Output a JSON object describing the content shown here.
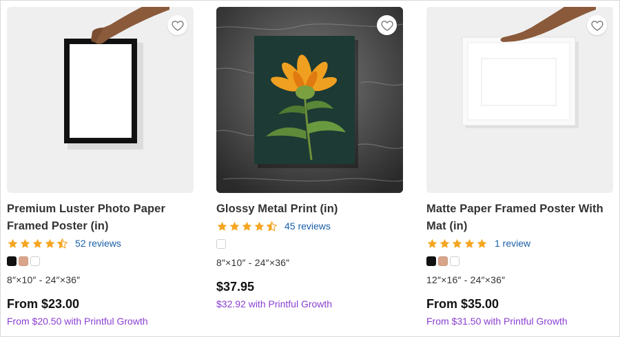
{
  "products": [
    {
      "title_line1": "Premium Luster Photo Paper",
      "title_line2": "Framed Poster (in)",
      "rating": 4.5,
      "reviews": "52 reviews",
      "swatches": [
        "#111111",
        "#d9a58a",
        "#ffffff"
      ],
      "size_range": "8″×10″ - 24″×36″",
      "price": "From $23.00",
      "growth_price": "From $20.50 with Printful Growth",
      "favorite_icon": "heart-outline-icon"
    },
    {
      "title_line1": "Glossy Metal Print (in)",
      "rating": 4.5,
      "reviews": "45 reviews",
      "swatches": [
        "#ffffff"
      ],
      "size_range": "8″×10″ - 24″×36″",
      "price": "$37.95",
      "growth_price": "$32.92 with Printful Growth",
      "favorite_icon": "heart-outline-icon"
    },
    {
      "title_line1": "Matte Paper Framed Poster With",
      "title_line2": "Mat (in)",
      "rating": 5,
      "reviews": "1 review",
      "swatches": [
        "#111111",
        "#d9a58a",
        "#ffffff"
      ],
      "size_range": "12″×16″ - 24″×36″",
      "price": "From $35.00",
      "growth_price": "From $31.50 with Printful Growth",
      "favorite_icon": "heart-outline-icon"
    }
  ],
  "colors": {
    "star": "#f5a623",
    "link": "#1a5fa8",
    "growth": "#8a3fd1"
  }
}
